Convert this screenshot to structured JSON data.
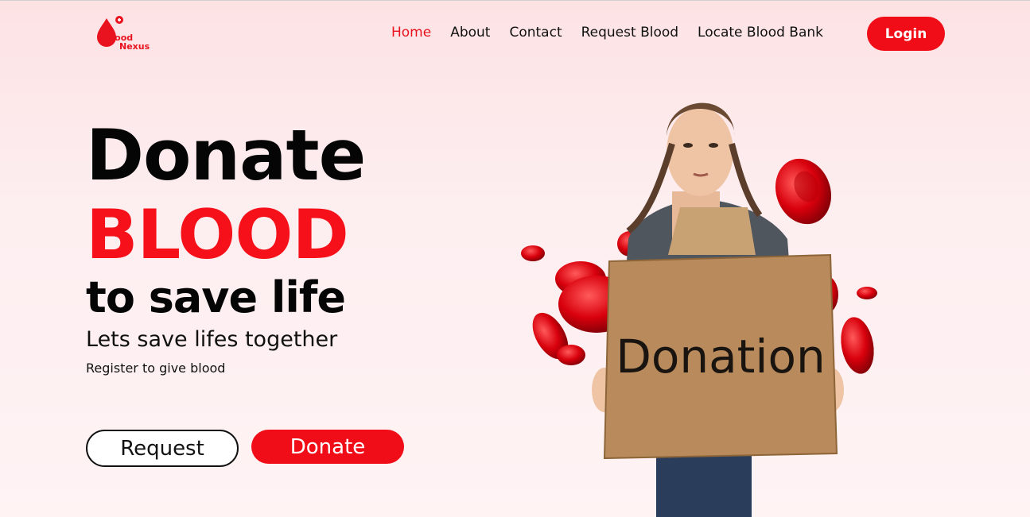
{
  "brand": {
    "line1": "Blood",
    "line2": "Nexus",
    "color": "#e8131f"
  },
  "nav": {
    "items": [
      {
        "label": "Home",
        "active": true
      },
      {
        "label": "About",
        "active": false
      },
      {
        "label": "Contact",
        "active": false
      },
      {
        "label": "Request Blood",
        "active": false
      },
      {
        "label": "Locate Blood Bank",
        "active": false
      }
    ],
    "login_label": "Login"
  },
  "hero": {
    "line1": "Donate",
    "line2": "BLOOD",
    "line3": "to save life",
    "subtitle": "Lets save lifes together",
    "note": "Register to give blood",
    "request_label": "Request",
    "donate_label": "Donate",
    "sign_text": "Donation"
  },
  "colors": {
    "accent": "#f00d17",
    "background": "#fde8ea"
  }
}
